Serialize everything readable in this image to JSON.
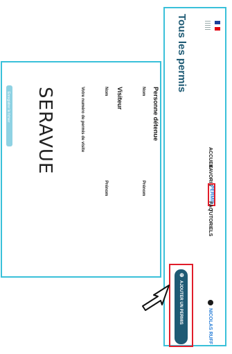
{
  "header": {
    "nav": [
      "ACCUEIL",
      "FAVORIS",
      "PERMIS",
      "FAQ",
      "TUTORIELS"
    ],
    "active_nav": "PERMIS",
    "user_name": "NICOLAS RUFF"
  },
  "page": {
    "title": "Tous les permis"
  },
  "card": {
    "holder_title": "Personne détenue",
    "name_label": "Nom",
    "first_name_label": "Prénom",
    "visitor_title": "Visiteur",
    "vehicle_label": "Votre numéro de permis de visite",
    "brand": "SERAVUE",
    "button_label": "Enregistrer le fichier"
  },
  "add_button": {
    "plus": "⊕",
    "label": "AJOUTER UN PERMIS"
  },
  "colors": {
    "teal": "#39c0d9",
    "navy": "#1e5a74",
    "red": "#e11d2a",
    "link": "#2a7fd8"
  }
}
